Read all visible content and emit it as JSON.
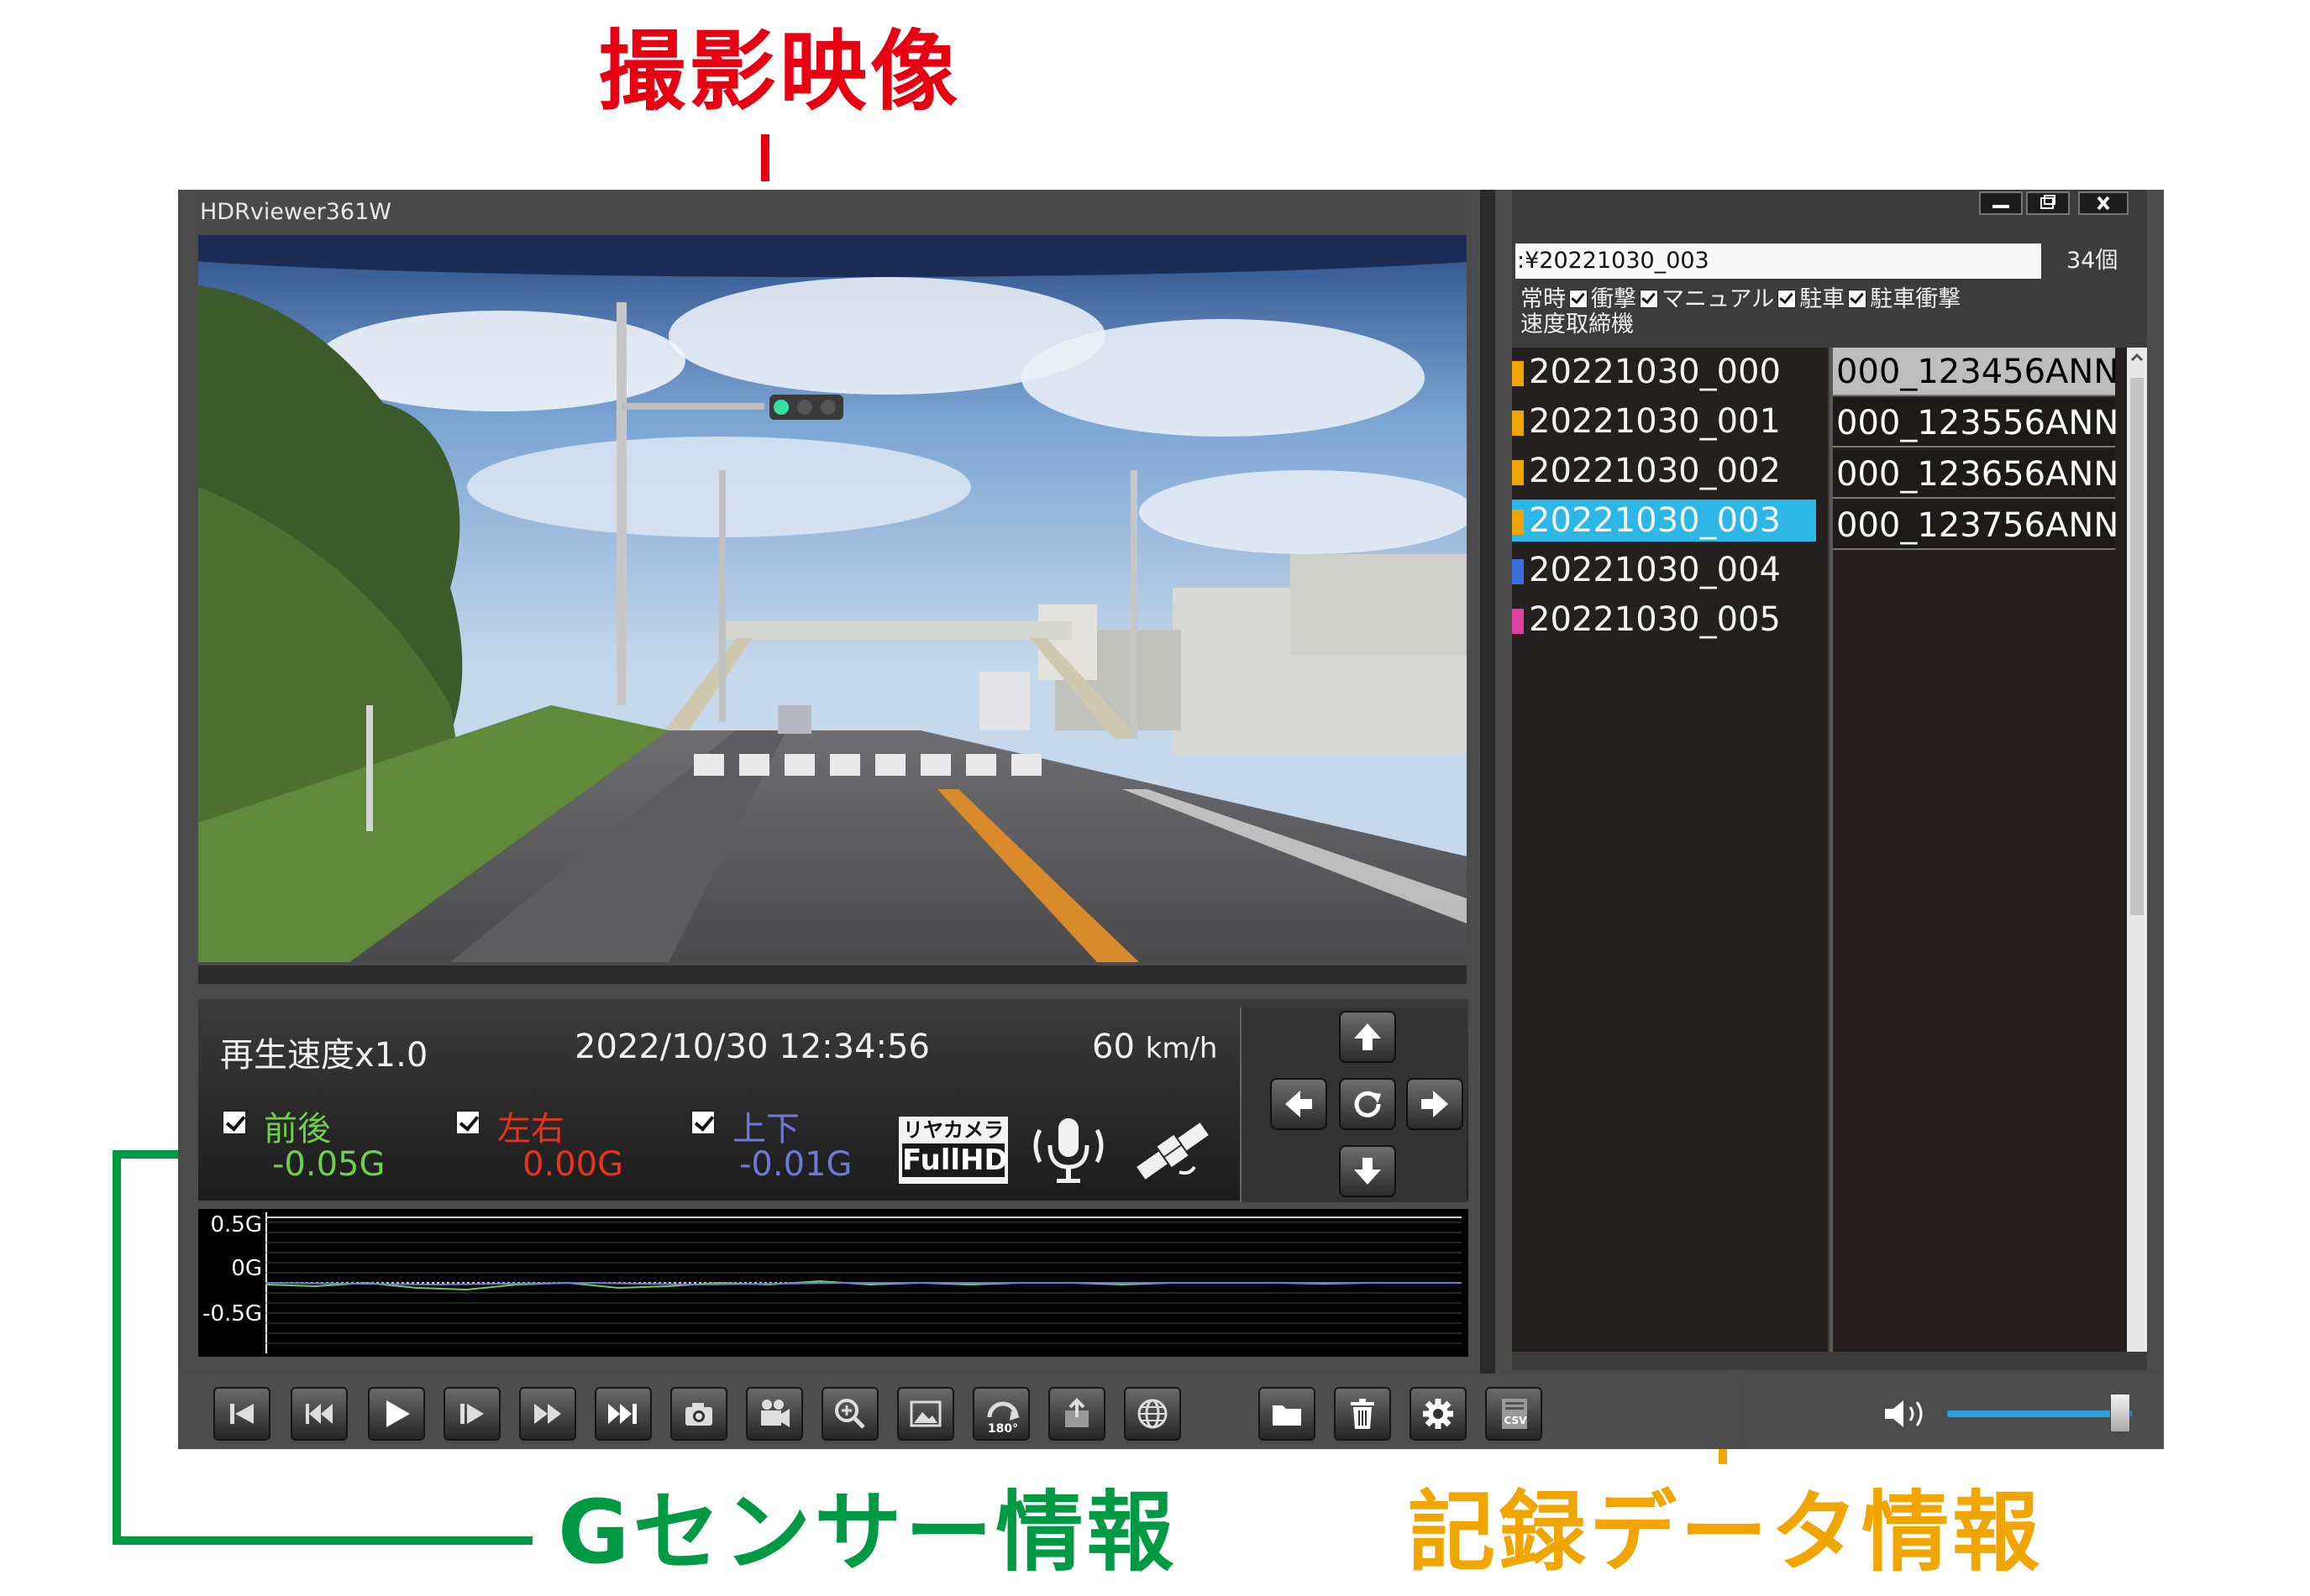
{
  "annotations": {
    "video_label": "撮影映像",
    "gsensor_label": "Gセンサー情報",
    "records_label": "記録データ情報",
    "colors": {
      "video": "#e60012",
      "gsensor": "#009944",
      "records": "#f0a500"
    }
  },
  "app": {
    "title": "HDRviewer361W"
  },
  "gsensor": {
    "playback_speed": "再生速度x1.0",
    "datetime": "2022/10/30 12:34:56",
    "speed_value": "60",
    "speed_unit": "km/h",
    "axes": [
      {
        "label": "前後",
        "value": "-0.05G",
        "color": "#6fcf4a",
        "checked": true
      },
      {
        "label": "左右",
        "value": "0.00G",
        "color": "#e8341c",
        "checked": true
      },
      {
        "label": "上下",
        "value": "-0.01G",
        "color": "#6f78d8",
        "checked": true
      }
    ],
    "rear_camera": {
      "line1": "リヤカメラ",
      "line2": "FullHD"
    },
    "icons": [
      "mic-icon",
      "gps-satellite-icon"
    ],
    "graph": {
      "ticks": [
        "0.5G",
        "0G",
        "-0.5G"
      ]
    },
    "dpad_icons": [
      "arrow-up-icon",
      "arrow-left-icon",
      "rotate-icon",
      "arrow-right-icon",
      "arrow-down-icon"
    ]
  },
  "records": {
    "path": ":¥20221030_003",
    "count": "34個",
    "filters": [
      {
        "label": "常時",
        "checked": true
      },
      {
        "label": "衝撃",
        "checked": true
      },
      {
        "label": "マニュアル",
        "checked": true
      },
      {
        "label": "駐車",
        "checked": true
      },
      {
        "label": "駐車衝撃",
        "checked": false
      }
    ],
    "filters_line2": "速度取締機",
    "folders": [
      {
        "name": "20221030_000",
        "icon_color": "#f0a500",
        "selected": false
      },
      {
        "name": "20221030_001",
        "icon_color": "#f0a500",
        "selected": false
      },
      {
        "name": "20221030_002",
        "icon_color": "#f0a500",
        "selected": false
      },
      {
        "name": "20221030_003",
        "icon_color": "#f0a500",
        "selected": true
      },
      {
        "name": "20221030_004",
        "icon_color": "#3a6fe0",
        "selected": false
      },
      {
        "name": "20221030_005",
        "icon_color": "#e040a0",
        "selected": false
      }
    ],
    "files": [
      {
        "name": "000_123456ANN",
        "selected": true
      },
      {
        "name": "000_123556ANN",
        "selected": false
      },
      {
        "name": "000_123656ANN",
        "selected": false
      },
      {
        "name": "000_123756ANN",
        "selected": false
      }
    ]
  },
  "toolbar": {
    "buttons": [
      "skip-start-icon",
      "rewind-icon",
      "play-icon",
      "step-forward-icon",
      "fast-forward-icon",
      "skip-end-icon",
      "camera-icon",
      "video-camera-icon",
      "zoom-icon",
      "image-icon",
      "rotate-180-icon",
      "export-icon",
      "globe-icon",
      "folder-icon",
      "trash-icon",
      "gear-icon",
      "csv-icon"
    ],
    "rotate_label": "180°",
    "csv_label": "CSV",
    "volume": {
      "level": 0.9
    }
  }
}
